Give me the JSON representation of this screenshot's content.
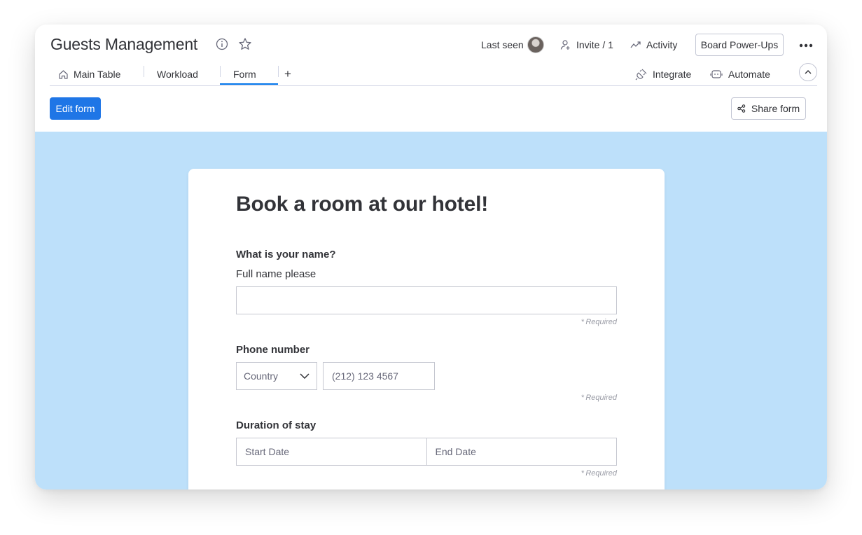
{
  "header": {
    "title": "Guests Management",
    "last_seen_label": "Last seen",
    "invite_label": "Invite / 1",
    "activity_label": "Activity",
    "power_ups_label": "Board Power-Ups"
  },
  "tabs": [
    {
      "label": "Main Table",
      "icon": "home-icon"
    },
    {
      "label": "Workload"
    },
    {
      "label": "Form",
      "active": true
    }
  ],
  "tab_add_label": "+",
  "integrations": {
    "integrate_label": "Integrate",
    "automate_label": "Automate"
  },
  "toolbar": {
    "edit_form_label": "Edit form",
    "share_form_label": "Share form"
  },
  "colors": {
    "accent": "#1f76e6",
    "active_tab": "#0073ea",
    "canvas_background": "#bde0fa"
  },
  "form": {
    "title": "Book a room at our hotel!",
    "required_label": "Required",
    "questions": [
      {
        "label": "What is your name?",
        "description": "Full name please",
        "value": "",
        "required": true
      },
      {
        "label": "Phone number",
        "country_placeholder": "Country",
        "phone_placeholder": "(212) 123 4567",
        "required": true
      },
      {
        "label": "Duration of stay",
        "start_placeholder": "Start Date",
        "end_placeholder": "End Date",
        "required": true
      }
    ]
  }
}
